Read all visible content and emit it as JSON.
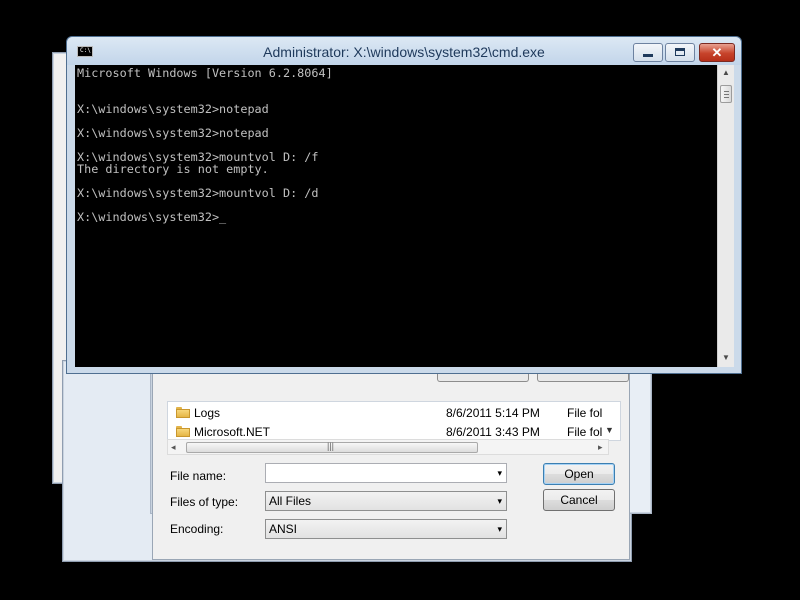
{
  "cmd_window": {
    "title": "Administrator: X:\\windows\\system32\\cmd.exe",
    "icon_text": "C:\\",
    "buttons": {
      "minimize": "minimize",
      "maximize": "maximize",
      "close": "✕"
    },
    "console_lines": [
      "Microsoft Windows [Version 6.2.8064]",
      "",
      "",
      "X:\\windows\\system32>notepad",
      "",
      "X:\\windows\\system32>notepad",
      "",
      "X:\\windows\\system32>mountvol D: /f",
      "The directory is not empty.",
      "",
      "X:\\windows\\system32>mountvol D: /d",
      "",
      "X:\\windows\\system32>"
    ],
    "cursor": "_"
  },
  "open_dialog": {
    "files": [
      {
        "name": "Logs",
        "date": "8/6/2011 5:14 PM",
        "type": "File fol"
      },
      {
        "name": "Microsoft.NET",
        "date": "8/6/2011 3:43 PM",
        "type": "File fol"
      }
    ],
    "scroll_grip": "|||",
    "file_name": {
      "label": "File name:",
      "value": ""
    },
    "files_of_type": {
      "label": "Files of type:",
      "value": "All Files"
    },
    "encoding": {
      "label": "Encoding:",
      "value": "ANSI"
    },
    "open_button": "Open",
    "cancel_button": "Cancel"
  },
  "icons": {
    "dropdown": "▾",
    "scroll_left": "◂",
    "scroll_right": "▸",
    "scroll_up": "▲",
    "scroll_down": "▼"
  }
}
